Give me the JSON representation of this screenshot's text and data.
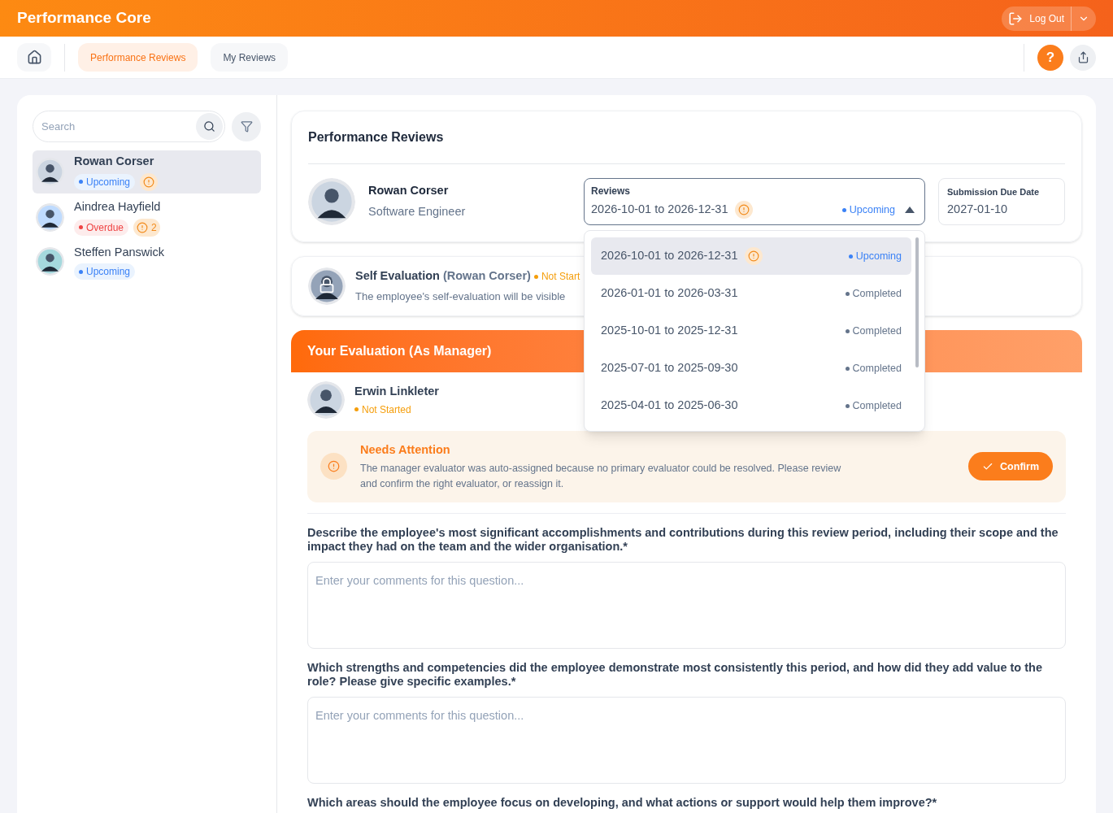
{
  "app": {
    "title": "Performance Core",
    "logout_button": "Log Out"
  },
  "nav": {
    "tabs": [
      {
        "label": "Performance Reviews",
        "selected": true
      },
      {
        "label": "My Reviews",
        "selected": false
      }
    ],
    "help_button": "?"
  },
  "sidebar": {
    "search": {
      "placeholder": "Search"
    },
    "employees": [
      {
        "name": "Rowan Corser",
        "selected": true,
        "status": {
          "label": "Upcoming",
          "kind": "upcoming"
        },
        "alert": true
      },
      {
        "name": "Aindrea Hayfield",
        "selected": false,
        "status": {
          "label": "Overdue",
          "kind": "overdue"
        },
        "alert": true,
        "alert_count": "2"
      },
      {
        "name": "Steffen Panswick",
        "selected": false,
        "status": {
          "label": "Upcoming",
          "kind": "upcoming"
        },
        "alert": false
      }
    ]
  },
  "review_header": {
    "title": "Performance Reviews",
    "employee": {
      "name": "Rowan Corser",
      "role": "Software Engineer"
    },
    "reviews_select": {
      "label": "Reviews",
      "value": "2026-10-01 to 2026-12-31",
      "alert": true,
      "status": {
        "label": "Upcoming",
        "kind": "upcoming"
      },
      "expanded": true,
      "options": [
        {
          "period": "2026-10-01 to 2026-12-31",
          "alert": true,
          "selected": true,
          "status": {
            "label": "Upcoming",
            "kind": "upcoming"
          }
        },
        {
          "period": "2026-01-01 to 2026-03-31",
          "alert": false,
          "selected": false,
          "status": {
            "label": "Completed",
            "kind": "completed"
          }
        },
        {
          "period": "2025-10-01 to 2025-12-31",
          "alert": false,
          "selected": false,
          "status": {
            "label": "Completed",
            "kind": "completed"
          }
        },
        {
          "period": "2025-07-01 to 2025-09-30",
          "alert": false,
          "selected": false,
          "status": {
            "label": "Completed",
            "kind": "completed"
          }
        },
        {
          "period": "2025-04-01 to 2025-06-30",
          "alert": false,
          "selected": false,
          "status": {
            "label": "Completed",
            "kind": "completed"
          }
        }
      ]
    },
    "due_date": {
      "label": "Submission Due Date",
      "value": "2027-01-10"
    }
  },
  "self_evaluation": {
    "title": "Self Evaluation",
    "owner": "(Rowan Corser)",
    "status": {
      "label": "Not Start",
      "kind": "not_started"
    },
    "description": "The employee's self-evaluation will be visible"
  },
  "manager_section": {
    "title": "Your Evaluation (As Manager)",
    "evaluator": {
      "name": "Erwin Linkleter",
      "status": {
        "label": "Not Started",
        "kind": "not_started"
      }
    },
    "notice": {
      "title": "Needs Attention",
      "text": "The manager evaluator was auto-assigned because no primary evaluator could be resolved. Please review and confirm the right evaluator, or reassign it.",
      "button": "Confirm"
    },
    "questions": [
      {
        "text": "Describe the employee's most significant accomplishments and contributions during this review period, including their scope and the impact they had on the team and the wider organisation.*",
        "placeholder": "Enter your comments for this question..."
      },
      {
        "text": "Which strengths and competencies did the employee demonstrate most consistently this period, and how did they add value to the role? Please give specific examples.*",
        "placeholder": "Enter your comments for this question..."
      },
      {
        "text": "Which areas should the employee focus on developing, and what actions or support would help them improve?*"
      }
    ]
  }
}
